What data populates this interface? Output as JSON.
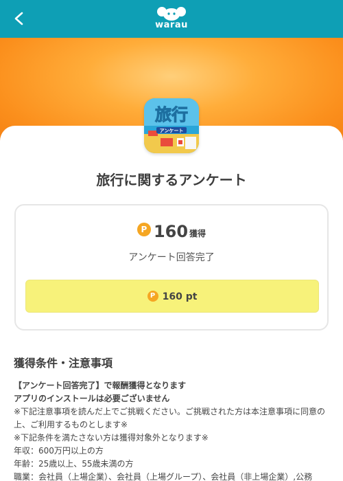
{
  "header": {
    "logo_text": "warau",
    "back_icon": "chevron-left-icon",
    "bar_color": "#0e9fb5"
  },
  "survey": {
    "icon_name": "travel-survey-app-icon",
    "icon_text_big": "旅行",
    "icon_text_tag": "アンケート",
    "title": "旅行に関するアンケート"
  },
  "reward": {
    "coin_symbol": "P",
    "points": "160",
    "points_unit": "獲得",
    "status": "アンケート回答完了",
    "button_label": "160 pt",
    "button_color": "#f7f27a",
    "coin_color": "#f5a623"
  },
  "conditions": {
    "title": "獲得条件・注意事項",
    "lines": [
      "【アンケート回答完了】で報酬獲得となります",
      "アプリのインストールは必要ございません",
      "※下記注意事項を読んだ上でご挑戦ください。ご挑戦された方は本注意事項に同意の上、ご利用するものとします※",
      "※下記条件を満たさない方は獲得対象外となります※",
      "年収：600万円以上の方",
      "年齢：25歳以上、55歳未満の方",
      "職業：会社員（上場企業）、会社員（上場グループ）、会社員（非上場企業）,公務"
    ]
  }
}
